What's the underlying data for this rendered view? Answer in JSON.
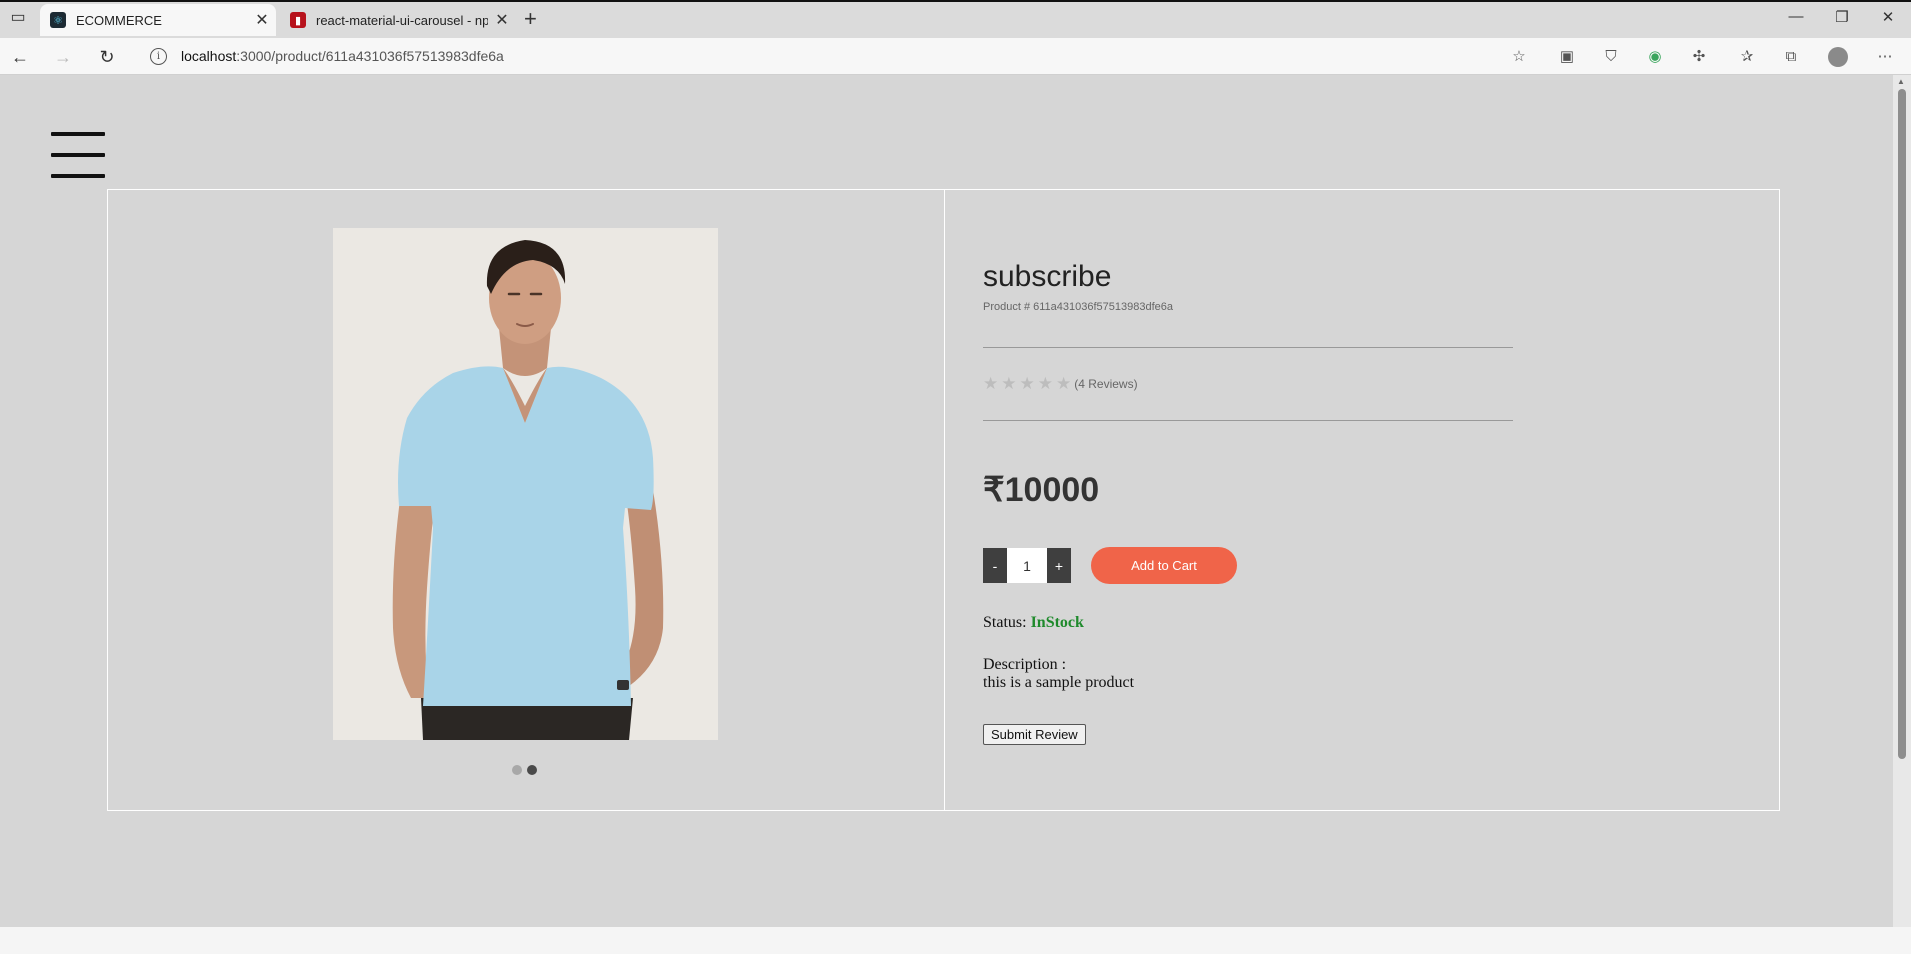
{
  "browser": {
    "tabs": [
      {
        "title": "ECOMMERCE",
        "favicon": "react-icon",
        "active": true
      },
      {
        "title": "react-material-ui-carousel - npm",
        "favicon": "npm-icon",
        "active": false
      }
    ],
    "url_host": "localhost",
    "url_path": ":3000/product/611a431036f57513983dfe6a"
  },
  "product": {
    "name": "subscribe",
    "id_line": "Product # 611a431036f57513983dfe6a",
    "rating": 0,
    "reviews": "(4 Reviews)",
    "price": "₹10000",
    "quantity": "1",
    "decrement_label": "-",
    "increment_label": "+",
    "add_to_cart_label": "Add to Cart",
    "status_label": "Status:",
    "status_value": "InStock",
    "description_label": "Description :",
    "description_text": "this is a sample product",
    "submit_review_label": "Submit Review",
    "carousel": {
      "slides": 2,
      "active_index": 1
    }
  },
  "colors": {
    "page_bg": "#d6d6d6",
    "accent": "#f06449",
    "instock": "#1f8a2c",
    "qty_btn": "#3f3f3f"
  }
}
